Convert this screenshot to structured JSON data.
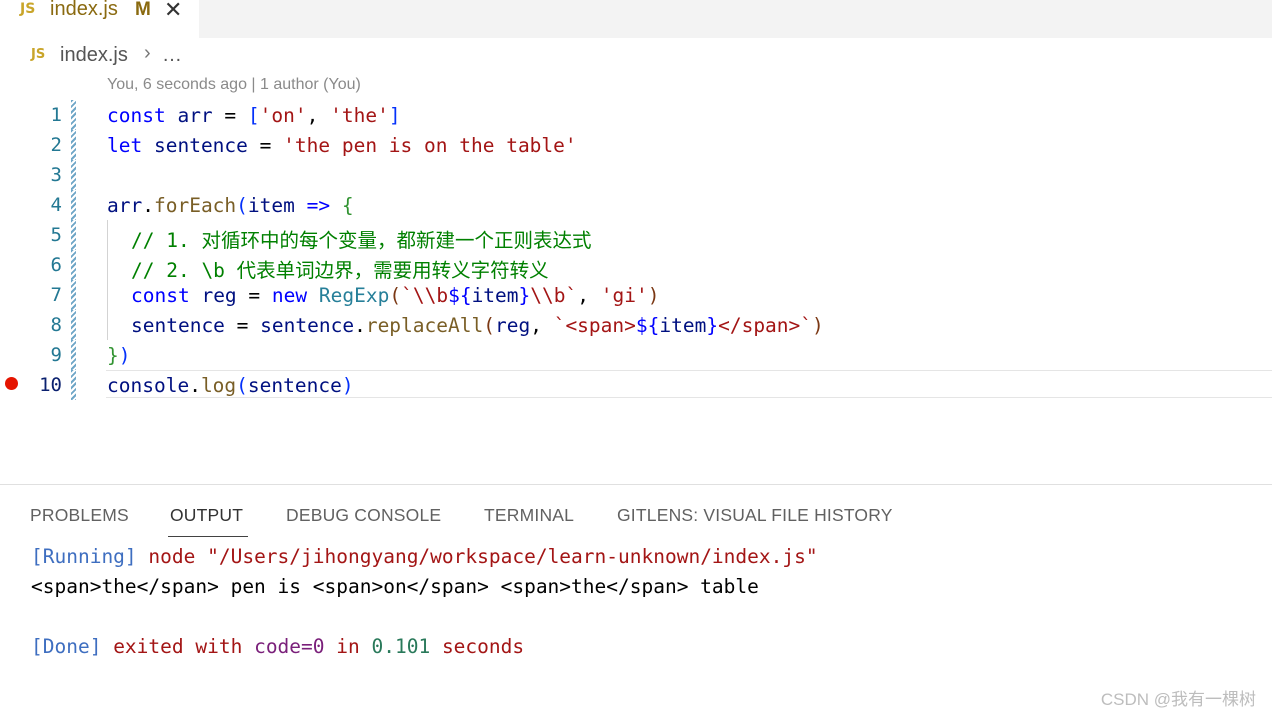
{
  "tab": {
    "badge": "JS",
    "filename": "index.js",
    "status": "M",
    "close": "✕"
  },
  "breadcrumb": {
    "badge": "JS",
    "file": "index.js",
    "chevron": "›",
    "more": "…"
  },
  "blame": "You, 6 seconds ago | 1 author (You)",
  "lines": [
    {
      "num": "1"
    },
    {
      "num": "2"
    },
    {
      "num": "3"
    },
    {
      "num": "4"
    },
    {
      "num": "5"
    },
    {
      "num": "6"
    },
    {
      "num": "7"
    },
    {
      "num": "8"
    },
    {
      "num": "9"
    },
    {
      "num": "10"
    }
  ],
  "code": {
    "l1": {
      "const": "const",
      "arr": "arr",
      "eq": " = ",
      "open": "[",
      "s1": "'on'",
      "comma": ", ",
      "s2": "'the'",
      "close": "]"
    },
    "l2": {
      "let": "let",
      "sentence": "sentence",
      "eq": " = ",
      "str": "'the pen is on the table'"
    },
    "l4": {
      "arr": "arr",
      "dot": ".",
      "fn": "forEach",
      "open": "(",
      "item": "item",
      "arrow": " => ",
      "brace": "{"
    },
    "l5": "// 1. 对循环中的每个变量，都新建一个正则表达式",
    "l6": "// 2. \\b 代表单词边界，需要用转义字符转义",
    "l7": {
      "const": "const",
      "reg": "reg",
      "eq": " = ",
      "new": "new",
      "cls": "RegExp",
      "open": "(",
      "t1": "`\\\\b",
      "d1": "${",
      "item": "item",
      "d2": "}",
      "t2": "\\\\b`",
      "comma": ", ",
      "s": "'gi'",
      "close": ")"
    },
    "l8": {
      "sentence": "sentence",
      "eq": " = ",
      "sentence2": "sentence",
      "dot": ".",
      "fn": "replaceAll",
      "open": "(",
      "reg": "reg",
      "comma": ", ",
      "t1": "`<span>",
      "d1": "${",
      "item": "item",
      "d2": "}",
      "t2": "</span>`",
      "close": ")"
    },
    "l9": {
      "brace": "}",
      "paren": ")"
    },
    "l10": {
      "console": "console",
      "dot": ".",
      "fn": "log",
      "open": "(",
      "arg": "sentence",
      "close": ")"
    }
  },
  "panel": {
    "tabs": [
      "PROBLEMS",
      "OUTPUT",
      "DEBUG CONSOLE",
      "TERMINAL",
      "GITLENS: VISUAL FILE HISTORY"
    ],
    "active_tab": "OUTPUT",
    "output": {
      "running_tag": "[Running]",
      "running_cmd": " node \"/Users/jihongyang/workspace/learn-unknown/index.js\"",
      "result": "<span>the</span> pen is <span>on</span> <span>the</span> table",
      "done_tag": "[Done]",
      "done_exited": " exited with ",
      "done_code": "code=0",
      "done_in": " in ",
      "done_time": "0.101",
      "done_seconds": " seconds"
    }
  },
  "watermark": "CSDN @我有一棵树"
}
